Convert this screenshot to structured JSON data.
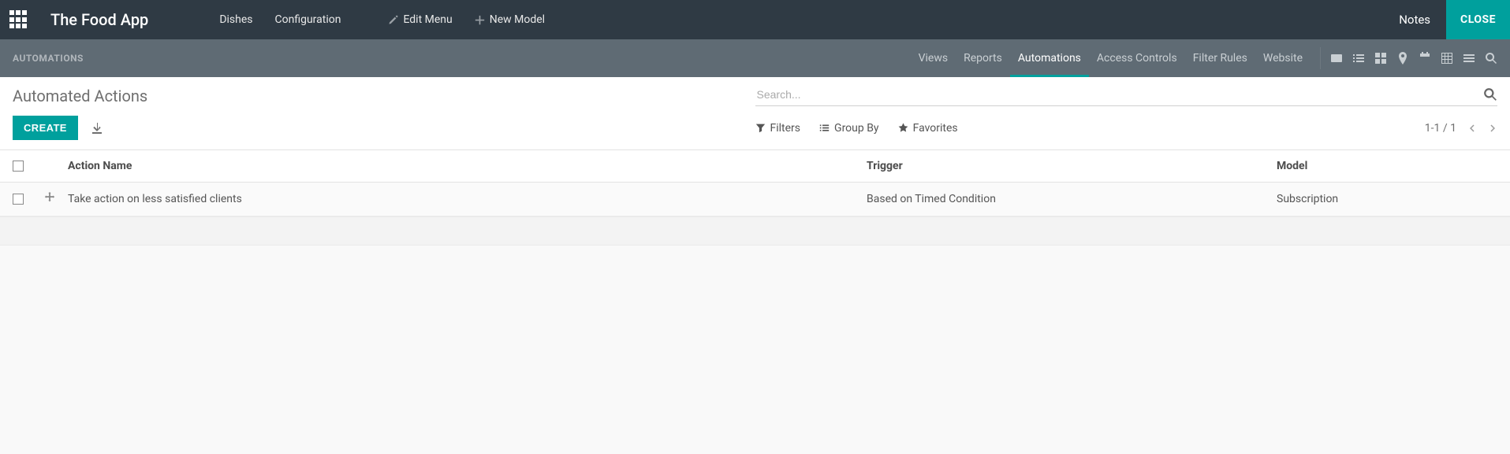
{
  "header": {
    "app_title": "The Food App",
    "menu": {
      "dishes": "Dishes",
      "configuration": "Configuration",
      "edit_menu": "Edit Menu",
      "new_model": "New Model"
    },
    "notes": "Notes",
    "close": "CLOSE"
  },
  "subheader": {
    "breadcrumb": "AUTOMATIONS",
    "tabs": {
      "views": "Views",
      "reports": "Reports",
      "automations": "Automations",
      "access_controls": "Access Controls",
      "filter_rules": "Filter Rules",
      "website": "Website"
    }
  },
  "control": {
    "page_title": "Automated Actions",
    "search_placeholder": "Search...",
    "create_label": "CREATE",
    "filters_label": "Filters",
    "groupby_label": "Group By",
    "favorites_label": "Favorites",
    "pager_text": "1-1 / 1"
  },
  "table": {
    "columns": {
      "action_name": "Action Name",
      "trigger": "Trigger",
      "model": "Model"
    },
    "rows": [
      {
        "action_name": "Take action on less satisfied clients",
        "trigger": "Based on Timed Condition",
        "model": "Subscription"
      }
    ]
  }
}
